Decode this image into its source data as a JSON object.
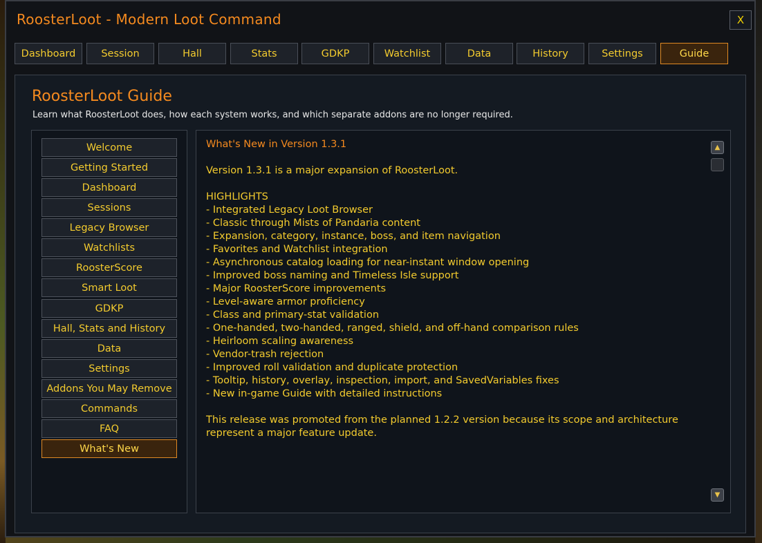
{
  "window": {
    "title": "RoosterLoot - Modern Loot Command",
    "close_label": "X"
  },
  "tabs": [
    {
      "label": "Dashboard",
      "active": false
    },
    {
      "label": "Session",
      "active": false
    },
    {
      "label": "Hall",
      "active": false
    },
    {
      "label": "Stats",
      "active": false
    },
    {
      "label": "GDKP",
      "active": false
    },
    {
      "label": "Watchlist",
      "active": false
    },
    {
      "label": "Data",
      "active": false
    },
    {
      "label": "History",
      "active": false
    },
    {
      "label": "Settings",
      "active": false
    },
    {
      "label": "Guide",
      "active": true
    }
  ],
  "guide": {
    "title": "RoosterLoot Guide",
    "subtitle": "Learn what RoosterLoot does, how each system works, and which separate addons are no longer required."
  },
  "nav": [
    {
      "label": "Welcome",
      "active": false
    },
    {
      "label": "Getting Started",
      "active": false
    },
    {
      "label": "Dashboard",
      "active": false
    },
    {
      "label": "Sessions",
      "active": false
    },
    {
      "label": "Legacy Browser",
      "active": false
    },
    {
      "label": "Watchlists",
      "active": false
    },
    {
      "label": "RoosterScore",
      "active": false
    },
    {
      "label": "Smart Loot",
      "active": false
    },
    {
      "label": "GDKP",
      "active": false
    },
    {
      "label": "Hall, Stats and History",
      "active": false
    },
    {
      "label": "Data",
      "active": false
    },
    {
      "label": "Settings",
      "active": false
    },
    {
      "label": "Addons You May Remove",
      "active": false
    },
    {
      "label": "Commands",
      "active": false
    },
    {
      "label": "FAQ",
      "active": false
    },
    {
      "label": "What's New",
      "active": true
    }
  ],
  "article": {
    "heading": "What's New in Version 1.3.1",
    "intro": "Version 1.3.1 is a major expansion of RoosterLoot.",
    "highlights_label": "HIGHLIGHTS",
    "highlights": [
      "- Integrated Legacy Loot Browser",
      "- Classic through Mists of Pandaria content",
      "- Expansion, category, instance, boss, and item navigation",
      "- Favorites and Watchlist integration",
      "- Asynchronous catalog loading for near-instant window opening",
      "- Improved boss naming and Timeless Isle support",
      "- Major RoosterScore improvements",
      "- Level-aware armor proficiency",
      "- Class and primary-stat validation",
      "- One-handed, two-handed, ranged, shield, and off-hand comparison rules",
      "- Heirloom scaling awareness",
      "- Vendor-trash rejection",
      "- Improved roll validation and duplicate protection",
      "- Tooltip, history, overlay, inspection, import, and SavedVariables fixes",
      "- New in-game Guide with detailed instructions"
    ],
    "closing": "This release was promoted from the planned 1.2.2 version because its scope and architecture represent a major feature update."
  },
  "scrollbar": {
    "up_icon": "scroll-up-icon",
    "down_icon": "scroll-down-icon"
  }
}
